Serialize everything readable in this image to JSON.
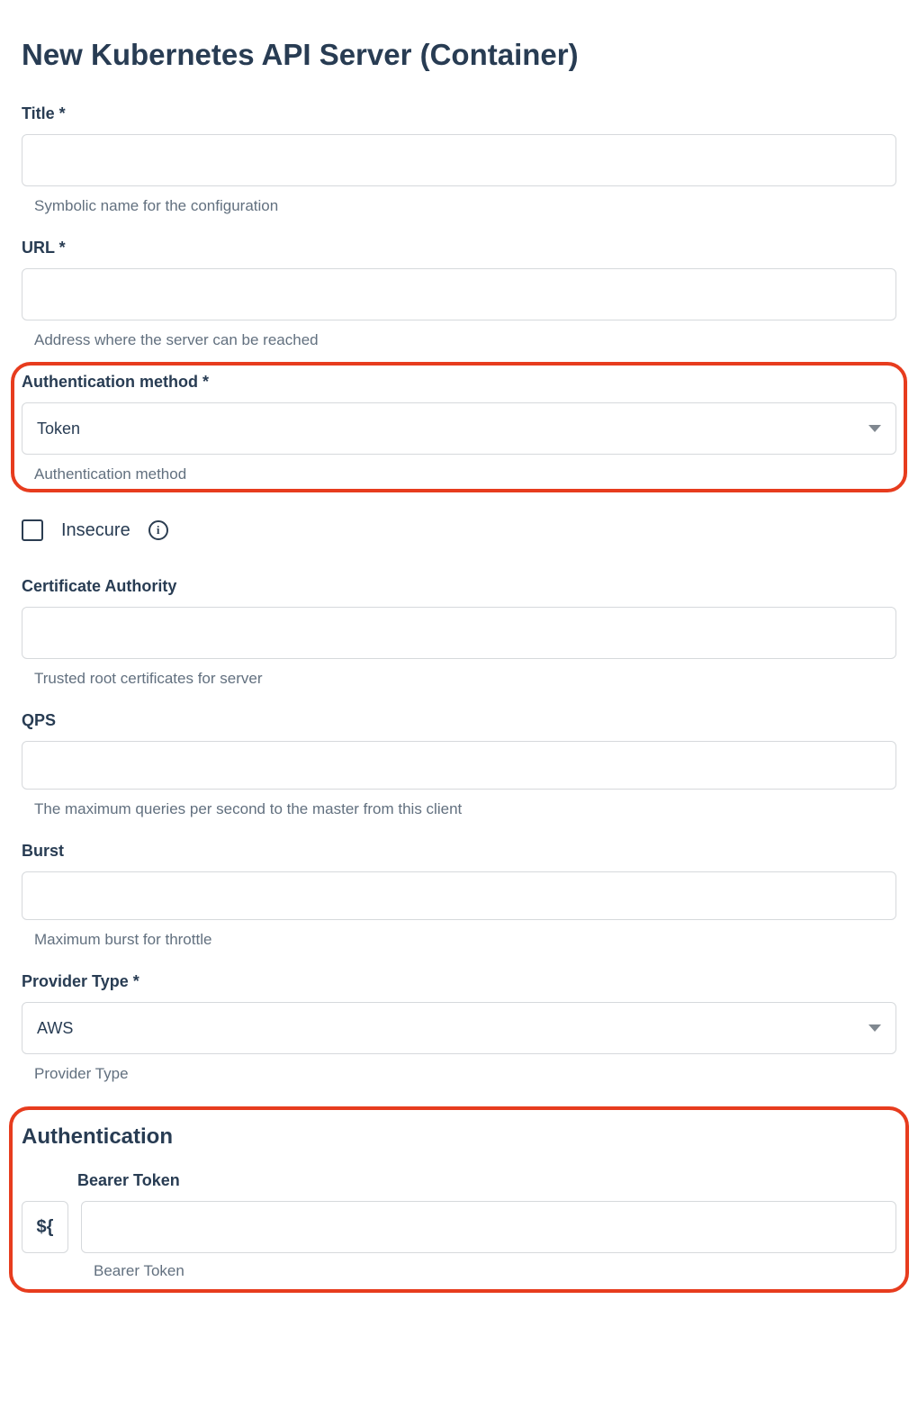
{
  "page_title": "New Kubernetes API Server (Container)",
  "fields": {
    "title": {
      "label": "Title *",
      "value": "",
      "helper": "Symbolic name for the configuration"
    },
    "url": {
      "label": "URL *",
      "value": "",
      "helper": "Address where the server can be reached"
    },
    "auth_method": {
      "label": "Authentication method *",
      "value": "Token",
      "helper": "Authentication method"
    },
    "insecure": {
      "label": "Insecure",
      "checked": false
    },
    "cert_authority": {
      "label": "Certificate Authority",
      "value": "",
      "helper": "Trusted root certificates for server"
    },
    "qps": {
      "label": "QPS",
      "value": "",
      "helper": "The maximum queries per second to the master from this client"
    },
    "burst": {
      "label": "Burst",
      "value": "",
      "helper": "Maximum burst for throttle"
    },
    "provider_type": {
      "label": "Provider Type *",
      "value": "AWS",
      "helper": "Provider Type"
    }
  },
  "auth_section": {
    "title": "Authentication",
    "bearer": {
      "label": "Bearer Token",
      "prefix": "${",
      "value": "",
      "helper": "Bearer Token"
    }
  }
}
